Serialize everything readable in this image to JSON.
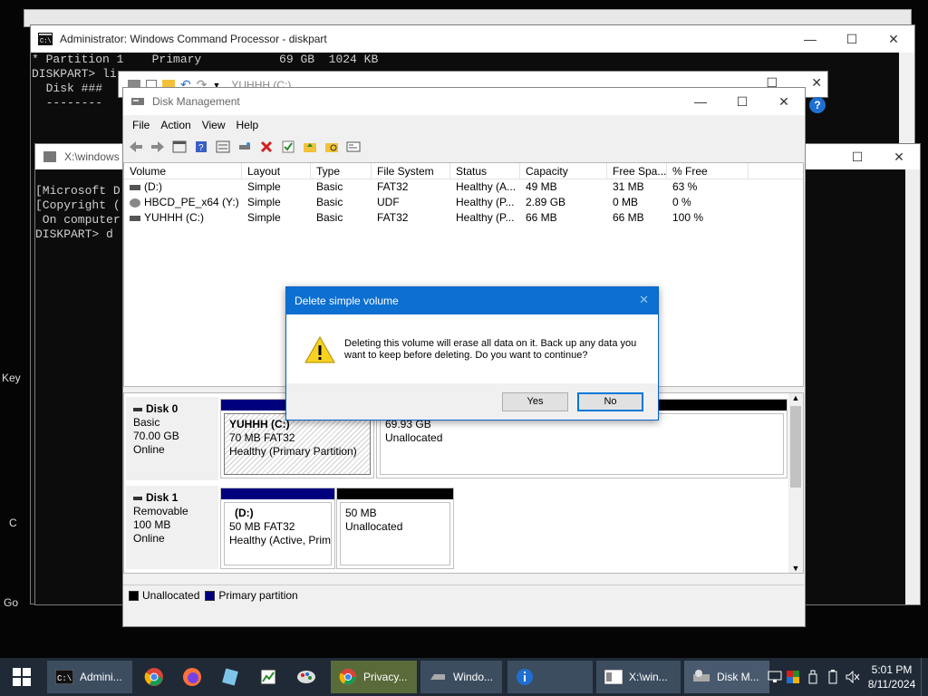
{
  "cmd_window": {
    "title": "Administrator: Windows Command Processor - diskpart",
    "lines": [
      "* Partition 1    Primary           69 GB  1024 KB",
      "",
      "DISKPART> li",
      "",
      "  Disk ###",
      "  --------"
    ]
  },
  "explorer_window": {
    "address": "YUHHH (C:)"
  },
  "second_window": {
    "title": "X:\\windows",
    "lines": [
      "[Microsoft D",
      "",
      "[Copyright (",
      " On computer",
      "",
      "DISKPART> d"
    ]
  },
  "desktop_text": {
    "keys_label": "Key",
    "c_label": "C",
    "go_label": "Go"
  },
  "disk_management": {
    "title": "Disk Management",
    "menu": [
      "File",
      "Action",
      "View",
      "Help"
    ],
    "columns": [
      "Volume",
      "Layout",
      "Type",
      "File System",
      "Status",
      "Capacity",
      "Free Spa...",
      "% Free"
    ],
    "rows": [
      [
        "(D:)",
        "Simple",
        "Basic",
        "FAT32",
        "Healthy (A...",
        "49 MB",
        "31 MB",
        "63 %"
      ],
      [
        "HBCD_PE_x64 (Y:)",
        "Simple",
        "Basic",
        "UDF",
        "Healthy (P...",
        "2.89 GB",
        "0 MB",
        "0 %"
      ],
      [
        "YUHHH (C:)",
        "Simple",
        "Basic",
        "FAT32",
        "Healthy (P...",
        "66 MB",
        "66 MB",
        "100 %"
      ]
    ],
    "disks": [
      {
        "name": "Disk 0",
        "type": "Basic",
        "size": "70.00 GB",
        "status": "Online",
        "partitions": [
          {
            "name": "YUHHH  (C:)",
            "size": "70 MB FAT32",
            "status": "Healthy (Primary Partition)"
          },
          {
            "name": "",
            "size": "69.93 GB",
            "status": "Unallocated"
          }
        ]
      },
      {
        "name": "Disk 1",
        "type": "Removable",
        "size": "100 MB",
        "status": "Online",
        "partitions": [
          {
            "name": "(D:)",
            "size": "50 MB FAT32",
            "status": "Healthy (Active, Prim"
          },
          {
            "name": "",
            "size": "50 MB",
            "status": "Unallocated"
          }
        ]
      }
    ],
    "legend": [
      "Unallocated",
      "Primary partition"
    ]
  },
  "dialog": {
    "title": "Delete simple volume",
    "message": "Deleting this volume will erase all data on it. Back up any data you want to keep before deleting. Do you want to continue?",
    "yes": "Yes",
    "no": "No"
  },
  "taskbar": {
    "items": [
      "Admini...",
      "Privacy...",
      "Windo...",
      "X:\\win...",
      "Disk M..."
    ],
    "time": "5:01 PM",
    "date": "8/11/2024"
  },
  "colors": {
    "primary_partition": "#00007f",
    "unallocated": "#000000",
    "dialog_title": "#0c6fd1",
    "taskbar": "#1f2a36"
  }
}
